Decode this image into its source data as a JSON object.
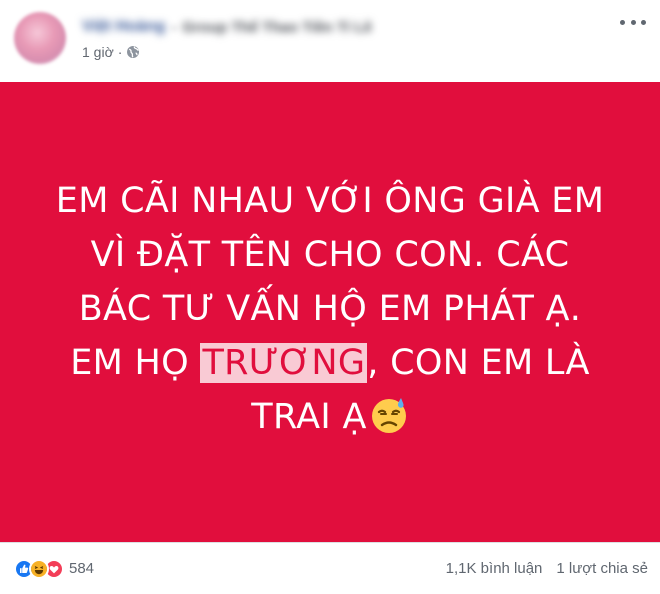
{
  "post": {
    "author": {
      "name": "Việt Hoàng",
      "separator": "›",
      "group": "Group Thể Thao Tiền Tỉ Lê"
    },
    "time": "1 giờ",
    "meta_dot": "·",
    "privacy_icon": "globe-icon",
    "body_lines": {
      "l1": "EM CÃI NHAU VỚI ÔNG GIÀ EM",
      "l2": "VÌ ĐẶT TÊN CHO CON. CÁC",
      "l3": "BÁC TƯ VẤN HỘ EM PHÁT Ạ.",
      "l4_pre": "EM HỌ ",
      "l4_highlight": "TRƯƠNG",
      "l4_post": ", CON EM LÀ",
      "l5": "TRAI Ạ"
    },
    "emoji": "downcast-sweat-face-icon",
    "card_color": "#e10e3d"
  },
  "footer": {
    "reaction_icons": [
      "like-icon",
      "haha-icon",
      "love-icon"
    ],
    "reaction_count": "584",
    "comments": "1,1K bình luận",
    "shares": "1 lượt chia sẻ"
  }
}
